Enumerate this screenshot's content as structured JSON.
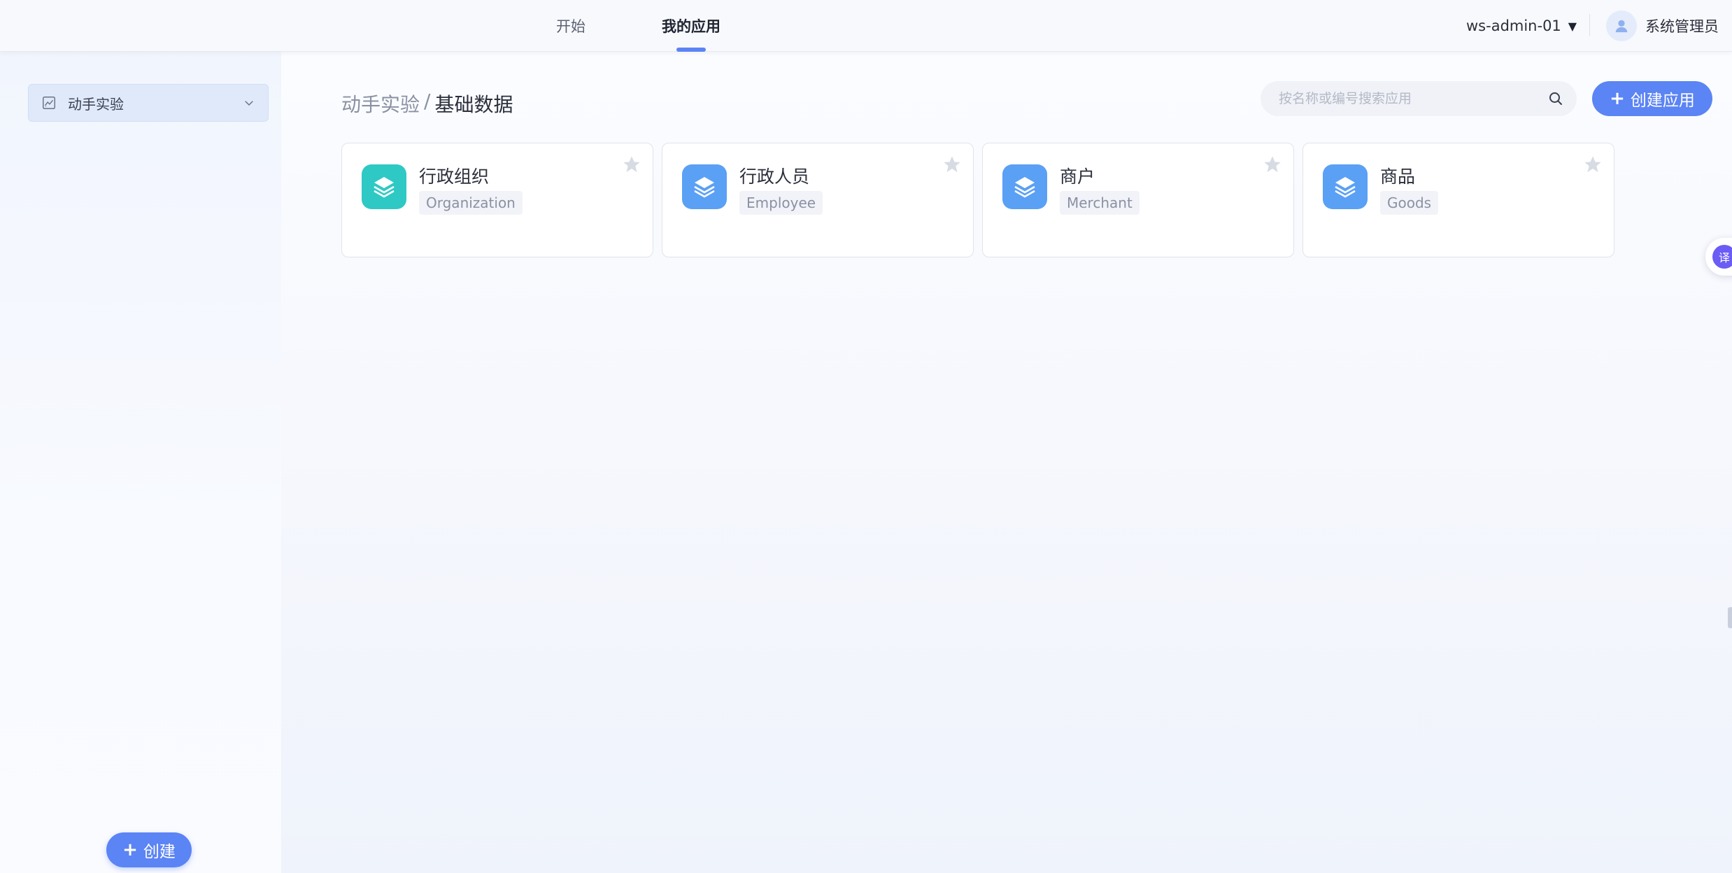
{
  "topbar": {
    "nav": [
      {
        "label": "开始",
        "active": false
      },
      {
        "label": "我的应用",
        "active": true
      }
    ],
    "workspace": "ws-admin-01",
    "user_name": "系统管理员"
  },
  "sidebar": {
    "project_label": "动手实验",
    "create_label": "创建"
  },
  "main": {
    "breadcrumb": {
      "parent": "动手实验",
      "separator": "/",
      "current": "基础数据"
    },
    "search": {
      "placeholder": "按名称或编号搜索应用"
    },
    "create_app_label": "创建应用",
    "cards": [
      {
        "title": "行政组织",
        "tag": "Organization",
        "icon_color": "#2ec9c4"
      },
      {
        "title": "行政人员",
        "tag": "Employee",
        "icon_color": "#5aa0f5"
      },
      {
        "title": "商户",
        "tag": "Merchant",
        "icon_color": "#5aa0f5"
      },
      {
        "title": "商品",
        "tag": "Goods",
        "icon_color": "#5aa0f5"
      }
    ]
  },
  "float_bubble": {
    "glyph": "译"
  },
  "icons": [
    "user-icon",
    "chart-icon",
    "chevron-down-icon",
    "search-icon",
    "plus-icon",
    "layers-icon",
    "star-icon"
  ],
  "colors": {
    "accent": "#5b84f4",
    "teal": "#2ec9c4",
    "blue": "#5aa0f5"
  }
}
